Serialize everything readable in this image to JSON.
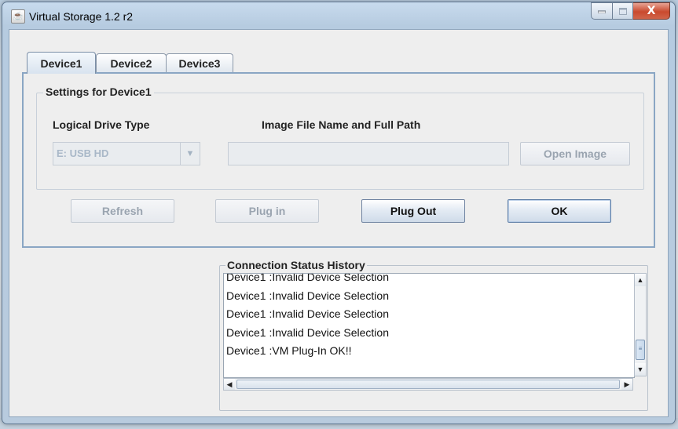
{
  "window": {
    "title": "Virtual Storage 1.2 r2",
    "close_glyph": "X"
  },
  "tabs": [
    {
      "label": "Device1",
      "active": true
    },
    {
      "label": "Device2",
      "active": false
    },
    {
      "label": "Device3",
      "active": false
    }
  ],
  "settings": {
    "group_title": "Settings for Device1",
    "drive_type_label": "Logical Drive Type",
    "drive_type_value": "E: USB HD",
    "image_path_label": "Image File Name and Full Path",
    "image_path_value": "",
    "open_image_label": "Open Image"
  },
  "actions": {
    "refresh_label": "Refresh",
    "plug_in_label": "Plug in",
    "plug_out_label": "Plug Out",
    "ok_label": "OK"
  },
  "history": {
    "title": "Connection Status History",
    "lines": [
      "Device1 :Invalid Device Selection",
      "Device1 :Invalid Device Selection",
      "Device1 :Invalid Device Selection",
      "Device1 :Invalid Device Selection",
      "Device1 :VM Plug-In OK!!"
    ]
  },
  "icons": {
    "app": "java-cup-icon",
    "minimize": "minimize-icon",
    "maximize": "maximize-icon",
    "close": "close-icon",
    "combo_arrow": "chevron-down-icon"
  }
}
